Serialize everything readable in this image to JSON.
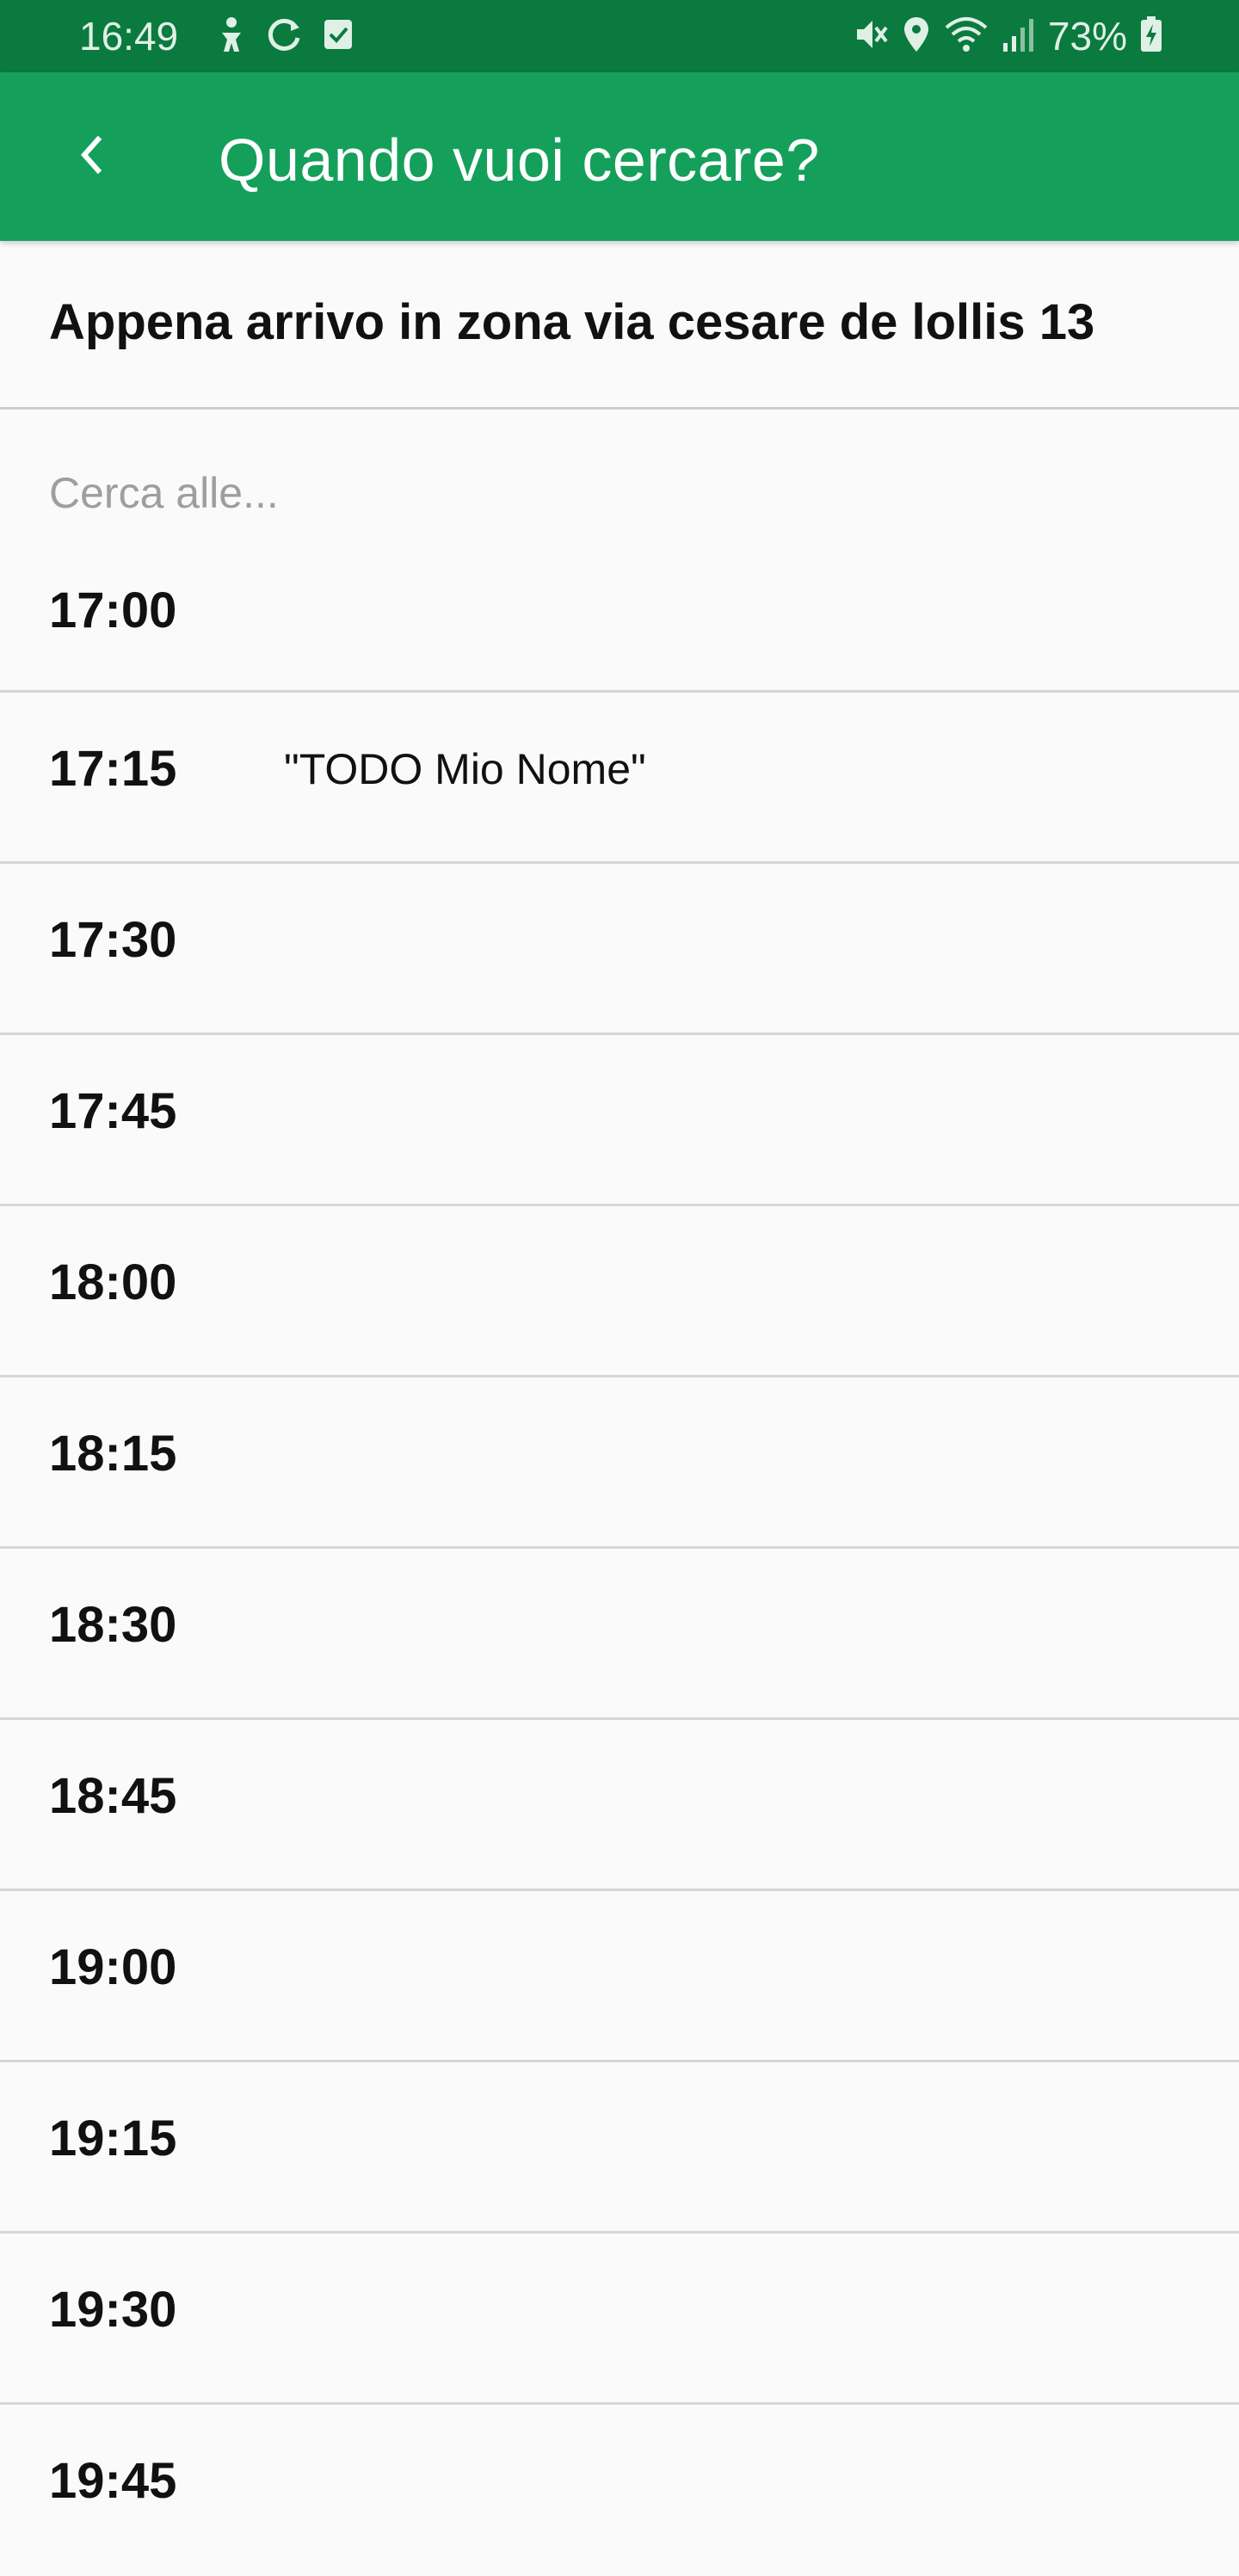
{
  "status_bar": {
    "time": "16:49",
    "battery_percent": "73%",
    "icons_left": [
      "accessibility-icon",
      "sync-icon",
      "checkbox-icon"
    ],
    "icons_right": [
      "mute-icon",
      "location-icon",
      "wifi-icon",
      "signal-icon",
      "battery-charging-icon"
    ]
  },
  "app_bar": {
    "title": "Quando vuoi cercare?",
    "back_icon": "chevron-left-icon"
  },
  "location": {
    "label": "Appena arrivo in zona via cesare de lollis 13"
  },
  "search": {
    "hint": "Cerca alle..."
  },
  "times": [
    {
      "time": "17:00",
      "note": ""
    },
    {
      "time": "17:15",
      "note": "\"TODO Mio Nome\""
    },
    {
      "time": "17:30",
      "note": ""
    },
    {
      "time": "17:45",
      "note": ""
    },
    {
      "time": "18:00",
      "note": ""
    },
    {
      "time": "18:15",
      "note": ""
    },
    {
      "time": "18:30",
      "note": ""
    },
    {
      "time": "18:45",
      "note": ""
    },
    {
      "time": "19:00",
      "note": ""
    },
    {
      "time": "19:15",
      "note": ""
    },
    {
      "time": "19:30",
      "note": ""
    },
    {
      "time": "19:45",
      "note": ""
    }
  ],
  "colors": {
    "status_bar": "#0b7a3e",
    "app_bar": "#14a05a",
    "background": "#fafafa",
    "divider": "#d6d6d6",
    "hint": "#9e9e9e"
  }
}
